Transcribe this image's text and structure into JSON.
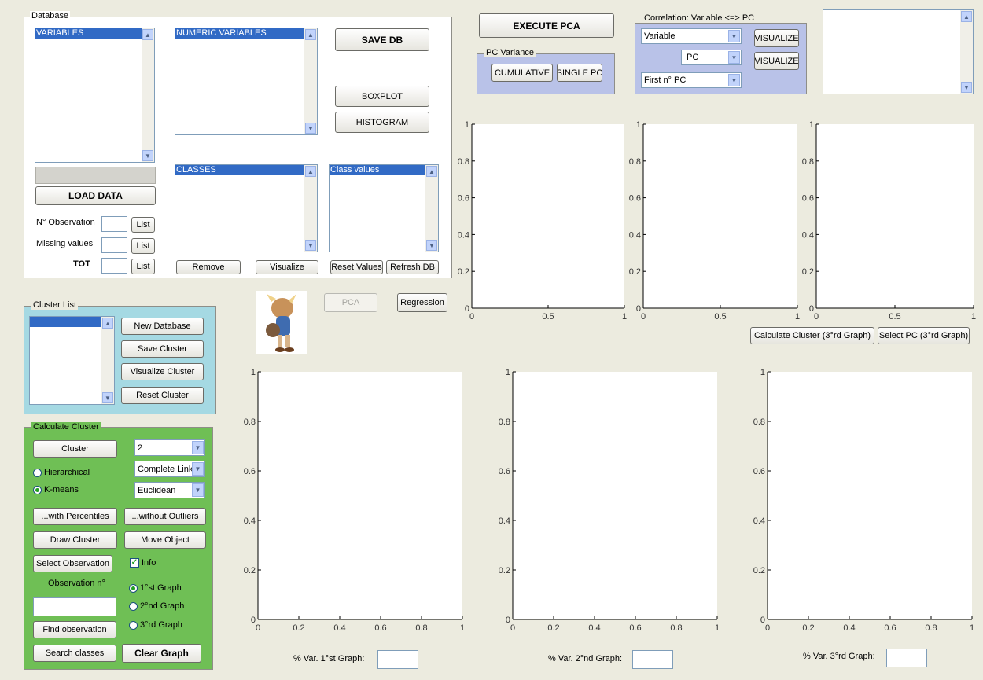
{
  "database": {
    "legend": "Database",
    "variables_header": "VARIABLES",
    "numeric_header": "NUMERIC VARIABLES",
    "classes_header": "CLASSES",
    "class_values_header": "Class values",
    "save_db": "SAVE DB",
    "boxplot": "BOXPLOT",
    "histogram": "HISTOGRAM",
    "load_data": "LOAD DATA",
    "n_observation": "N° Observation",
    "missing_values": "Missing values",
    "tot": "TOT",
    "list": "List",
    "remove": "Remove",
    "visualize": "Visualize",
    "reset_values": "Reset Values",
    "refresh_db": "Refresh DB"
  },
  "pca": {
    "execute": "EXECUTE PCA",
    "variance_legend": "PC Variance",
    "cumulative": "CUMULATIVE",
    "single_pc": "SINGLE PC",
    "pca_button": "PCA",
    "regression": "Regression"
  },
  "correlation": {
    "legend": "Correlation: Variable <=> PC",
    "variable_select": "Variable",
    "pc_select": "PC",
    "first_n_select": "First n° PC",
    "visualize1": "VISUALIZE",
    "visualize2": "VISUALIZE"
  },
  "cluster_list": {
    "legend": "Cluster List",
    "new_database": "New Database",
    "save_cluster": "Save Cluster",
    "visualize_cluster": "Visualize Cluster",
    "reset_cluster": "Reset Cluster"
  },
  "calc_cluster": {
    "legend": "Calculate Cluster",
    "cluster_btn": "Cluster",
    "k_value": "2",
    "linkage": "Complete Link",
    "distance": "Euclidean",
    "hierarchical": "Hierarchical",
    "kmeans": "K-means",
    "with_percentiles": "...with Percentiles",
    "without_outliers": "...without Outliers",
    "draw_cluster": "Draw Cluster",
    "move_object": "Move Object",
    "select_observation": "Select Observation",
    "info": "Info",
    "observation_n": "Observation n°",
    "first_graph": "1°st Graph",
    "second_graph": "2°nd Graph",
    "third_graph": "3°rd Graph",
    "find_observation": "Find observation",
    "search_classes": "Search classes",
    "clear_graph": "Clear Graph"
  },
  "graph_buttons": {
    "calc_cluster3": "Calculate Cluster (3°rd Graph)",
    "select_pc3": "Select PC (3°rd Graph)"
  },
  "var_labels": {
    "first": "% Var. 1°st Graph:",
    "second": "% Var. 2°nd Graph:",
    "third": "% Var. 3°rd Graph:"
  },
  "axes": {
    "small_y_ticks": [
      "0",
      "0.2",
      "0.4",
      "0.6",
      "0.8",
      "1"
    ],
    "small_x_ticks": [
      "0",
      "0.5",
      "1"
    ],
    "large_y_ticks": [
      "0",
      "0.2",
      "0.4",
      "0.6",
      "0.8",
      "1"
    ],
    "large_x_ticks": [
      "0",
      "0.2",
      "0.4",
      "0.6",
      "0.8",
      "1"
    ]
  },
  "colors": {
    "cluster_list_bg": "#a5d9e3",
    "calc_cluster_bg": "#6fbf55",
    "pca_panel_bg": "#b9c2e8",
    "selection": "#316ac5"
  },
  "icons": {
    "logo": "cartoon-character-logo"
  }
}
